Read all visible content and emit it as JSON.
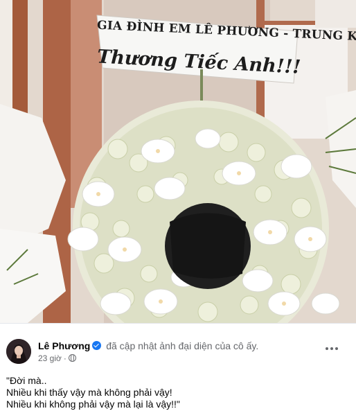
{
  "photo": {
    "banner_line1": "GIA ĐÌNH EM LÊ PHƯƠNG - TRUNG KIÊN",
    "banner_line2": "Thương Tiếc Anh!!!"
  },
  "post": {
    "author": "Lê Phương",
    "action": "đã cập nhật ảnh đại diện của cô ấy.",
    "time": "23 giờ",
    "dot": "·",
    "privacy_icon": "globe-icon",
    "more_icon": "more-horizontal-icon",
    "caption_lines": [
      "\"Đời mà..",
      "Nhiều khi thấy vậy mà không phải vậy!",
      "Nhiều khi không phải vậy mà lại là vậy!!\""
    ]
  },
  "colors": {
    "verified": "#1877f2",
    "secondary_text": "#65676b",
    "primary_text": "#050505"
  }
}
